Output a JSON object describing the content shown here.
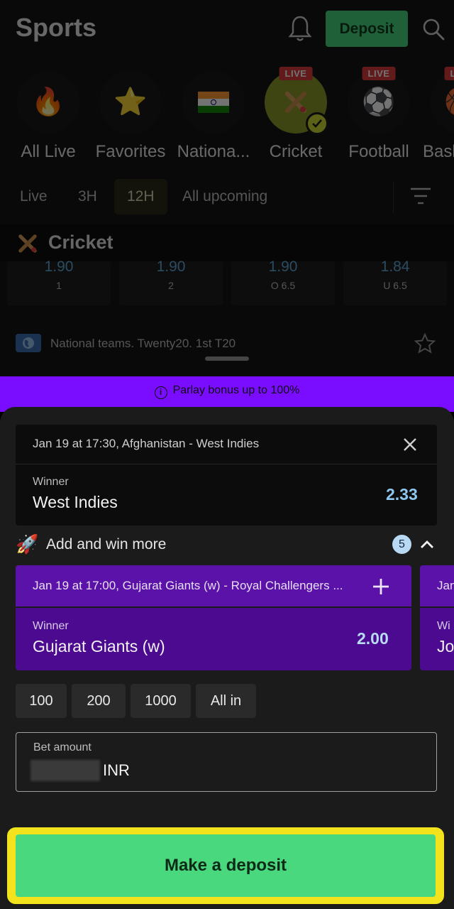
{
  "header": {
    "title": "Sports",
    "deposit_label": "Deposit"
  },
  "sports": [
    {
      "label": "All Live",
      "icon": "fire-icon",
      "live": false
    },
    {
      "label": "Favorites",
      "icon": "star-icon",
      "live": false
    },
    {
      "label": "Nationa...",
      "icon": "india-flag-icon",
      "live": false
    },
    {
      "label": "Cricket",
      "icon": "cricket-icon",
      "live": true,
      "selected": true
    },
    {
      "label": "Football",
      "icon": "football-icon",
      "live": true
    },
    {
      "label": "Bask",
      "icon": "basketball-icon",
      "live": true
    }
  ],
  "live_badge": "LIVE",
  "time_filters": {
    "live": "Live",
    "h3": "3H",
    "h12": "12H",
    "upcoming": "All upcoming",
    "active": "12H"
  },
  "section": {
    "title": "Cricket"
  },
  "odds_row": [
    {
      "value": "1.90",
      "label": "1"
    },
    {
      "value": "1.90",
      "label": "2"
    },
    {
      "value": "1.90",
      "label": "O 6.5"
    },
    {
      "value": "1.84",
      "label": "U 6.5"
    }
  ],
  "league": {
    "name": "National teams. Twenty20. 1st T20"
  },
  "parlay": {
    "text": "Parlay bonus up to 100%"
  },
  "bet": {
    "event": "Jan 19 at 17:30, Afghanistan - West Indies",
    "market": "Winner",
    "pick": "West Indies",
    "odds": "2.33"
  },
  "add_win": {
    "label": "Add and win more",
    "count": "5"
  },
  "suggestion": {
    "event": "Jan 19 at 17:00, Gujarat Giants (w) - Royal Challengers ...",
    "market": "Winner",
    "pick": "Gujarat Giants (w)",
    "odds": "2.00"
  },
  "suggestion_peek": {
    "event": "Jan",
    "market": "Wi",
    "pick": "Jo"
  },
  "quick_amounts": [
    "100",
    "200",
    "1000",
    "All in"
  ],
  "bet_amount": {
    "label": "Bet amount",
    "currency": "INR"
  },
  "cta": {
    "label": "Make a deposit"
  },
  "colors": {
    "deposit_green": "#48d67d",
    "parlay_purple": "#7a0cff",
    "suggest_purple": "#4b0a8f",
    "highlight_yellow": "#f2e31c",
    "odds_blue": "#8ec7f0"
  }
}
